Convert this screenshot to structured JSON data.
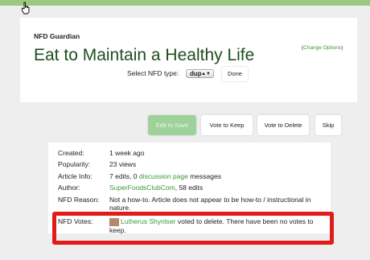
{
  "header": {
    "guardian": "NFD Guardian",
    "change_options": "Change Options",
    "title": "Eat to Maintain a Healthy Life",
    "select_label": "Select NFD type:",
    "select_value": "dup",
    "done_label": "Done"
  },
  "actions": {
    "edit": "Edit to Save",
    "keep": "Vote to Keep",
    "delete": "Vote to Delete",
    "skip": "Skip"
  },
  "info": {
    "created_label": "Created:",
    "created_value": "1 week ago",
    "popularity_label": "Popularity:",
    "popularity_value": "23 views",
    "article_label": "Article Info:",
    "article_prefix": "7 edits, 0",
    "article_link": "discussion page",
    "article_suffix": "messages",
    "author_label": "Author:",
    "author_link": "SuperFoodsClubCom",
    "author_suffix": ", 58 edits",
    "reason_label": "NFD Reason:",
    "reason_value": "Not a how-to. Article does not appear to be how-to / instructional in nature.",
    "votes_label": "NFD Votes:",
    "votes_user": "Lutherus Shynlser",
    "votes_text": "voted to delete. There have been no votes to keep."
  },
  "colors": {
    "accent": "#3a9a3a",
    "highlight": "#e31a1a",
    "topbar": "#9bc97f"
  }
}
